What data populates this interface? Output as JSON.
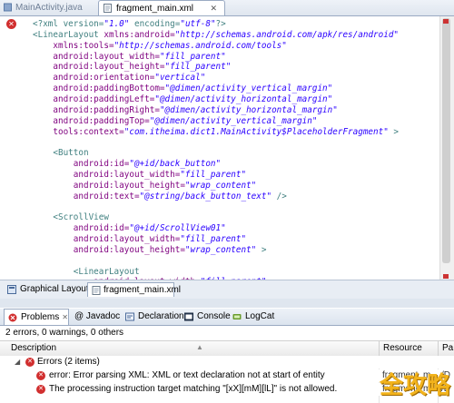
{
  "editor_tabs": [
    {
      "label": "MainActivity.java",
      "active": false
    },
    {
      "label": "fragment_main.xml",
      "active": true,
      "close": "✕"
    }
  ],
  "code_lines": [
    [
      {
        "t": "tag",
        "v": "<?xml version="
      },
      {
        "t": "val",
        "v": "\"1.0\""
      },
      {
        "t": "tag",
        "v": " encoding="
      },
      {
        "t": "val",
        "v": "\"utf-8\""
      },
      {
        "t": "tag",
        "v": "?>"
      }
    ],
    [
      {
        "t": "tag",
        "v": "<LinearLayout "
      },
      {
        "t": "attr",
        "v": "xmlns:android="
      },
      {
        "t": "val",
        "v": "\"http://schemas.android.com/apk/res/android\""
      }
    ],
    [
      {
        "t": "plain",
        "v": "    "
      },
      {
        "t": "attr",
        "v": "xmlns:tools="
      },
      {
        "t": "val",
        "v": "\"http://schemas.android.com/tools\""
      }
    ],
    [
      {
        "t": "plain",
        "v": "    "
      },
      {
        "t": "attr",
        "v": "android:layout_width="
      },
      {
        "t": "val",
        "v": "\"fill_parent\""
      }
    ],
    [
      {
        "t": "plain",
        "v": "    "
      },
      {
        "t": "attr",
        "v": "android:layout_height="
      },
      {
        "t": "val",
        "v": "\"fill_parent\""
      }
    ],
    [
      {
        "t": "plain",
        "v": "    "
      },
      {
        "t": "attr",
        "v": "android:orientation="
      },
      {
        "t": "val",
        "v": "\"vertical\""
      }
    ],
    [
      {
        "t": "plain",
        "v": "    "
      },
      {
        "t": "attr",
        "v": "android:paddingBottom="
      },
      {
        "t": "val",
        "v": "\"@dimen/activity_vertical_margin\""
      }
    ],
    [
      {
        "t": "plain",
        "v": "    "
      },
      {
        "t": "attr",
        "v": "android:paddingLeft="
      },
      {
        "t": "val",
        "v": "\"@dimen/activity_horizontal_margin\""
      }
    ],
    [
      {
        "t": "plain",
        "v": "    "
      },
      {
        "t": "attr",
        "v": "android:paddingRight="
      },
      {
        "t": "val",
        "v": "\"@dimen/activity_horizontal_margin\""
      }
    ],
    [
      {
        "t": "plain",
        "v": "    "
      },
      {
        "t": "attr",
        "v": "android:paddingTop="
      },
      {
        "t": "val",
        "v": "\"@dimen/activity_vertical_margin\""
      }
    ],
    [
      {
        "t": "plain",
        "v": "    "
      },
      {
        "t": "attr",
        "v": "tools:context="
      },
      {
        "t": "val",
        "v": "\"com.itheima.dict1.MainActivity$PlaceholderFragment\""
      },
      {
        "t": "tag",
        "v": " >"
      }
    ],
    [],
    [
      {
        "t": "plain",
        "v": "    "
      },
      {
        "t": "tag",
        "v": "<Button"
      }
    ],
    [
      {
        "t": "plain",
        "v": "        "
      },
      {
        "t": "attr",
        "v": "android:id="
      },
      {
        "t": "val",
        "v": "\"@+id/back_button\""
      }
    ],
    [
      {
        "t": "plain",
        "v": "        "
      },
      {
        "t": "attr",
        "v": "android:layout_width="
      },
      {
        "t": "val",
        "v": "\"fill_parent\""
      }
    ],
    [
      {
        "t": "plain",
        "v": "        "
      },
      {
        "t": "attr",
        "v": "android:layout_height="
      },
      {
        "t": "val",
        "v": "\"wrap_content\""
      }
    ],
    [
      {
        "t": "plain",
        "v": "        "
      },
      {
        "t": "attr",
        "v": "android:text="
      },
      {
        "t": "val",
        "v": "\"@string/back_button_text\""
      },
      {
        "t": "tag",
        "v": " />"
      }
    ],
    [],
    [
      {
        "t": "plain",
        "v": "    "
      },
      {
        "t": "tag",
        "v": "<ScrollView"
      }
    ],
    [
      {
        "t": "plain",
        "v": "        "
      },
      {
        "t": "attr",
        "v": "android:id="
      },
      {
        "t": "val",
        "v": "\"@+id/ScrollView01\""
      }
    ],
    [
      {
        "t": "plain",
        "v": "        "
      },
      {
        "t": "attr",
        "v": "android:layout_width="
      },
      {
        "t": "val",
        "v": "\"fill_parent\""
      }
    ],
    [
      {
        "t": "plain",
        "v": "        "
      },
      {
        "t": "attr",
        "v": "android:layout_height="
      },
      {
        "t": "val",
        "v": "\"wrap_content\""
      },
      {
        "t": "tag",
        "v": " >"
      }
    ],
    [],
    [
      {
        "t": "plain",
        "v": "        "
      },
      {
        "t": "tag",
        "v": "<LinearLayout"
      }
    ],
    [
      {
        "t": "plain",
        "v": "            "
      },
      {
        "t": "attr",
        "v": "android:layout_width="
      },
      {
        "t": "val",
        "v": "\"fill_parent\""
      }
    ]
  ],
  "editor_bottom_tabs": {
    "graphical": "Graphical Layout",
    "xml": "fragment_main.xml"
  },
  "view_tabs": [
    {
      "label": "Problems",
      "icon": "problems-icon"
    },
    {
      "label": "@ Javadoc",
      "icon": "javadoc-icon"
    },
    {
      "label": "Declaration",
      "icon": "declaration-icon"
    },
    {
      "label": "Console",
      "icon": "console-icon"
    },
    {
      "label": "LogCat",
      "icon": "logcat-icon"
    }
  ],
  "problems": {
    "summary": "2 errors, 0 warnings, 0 others",
    "columns": {
      "description": "Description",
      "resource": "Resource",
      "path": "Pa"
    },
    "group": {
      "label": "Errors (2 items)",
      "expander": "◢"
    },
    "rows": [
      {
        "description": "error: Error parsing XML: XML or text declaration not at start of entity",
        "resource": "fragment_m",
        "path": "/D"
      },
      {
        "description": "The processing instruction target matching \"[xX][mM][lL]\" is not allowed.",
        "resource": "fragment_m",
        "path": "/D"
      }
    ]
  },
  "watermark": "全攻略",
  "colors": {
    "tag": "#3f7f7f",
    "attr": "#7f007f",
    "value": "#2a00ff",
    "error": "#d12f2f"
  }
}
